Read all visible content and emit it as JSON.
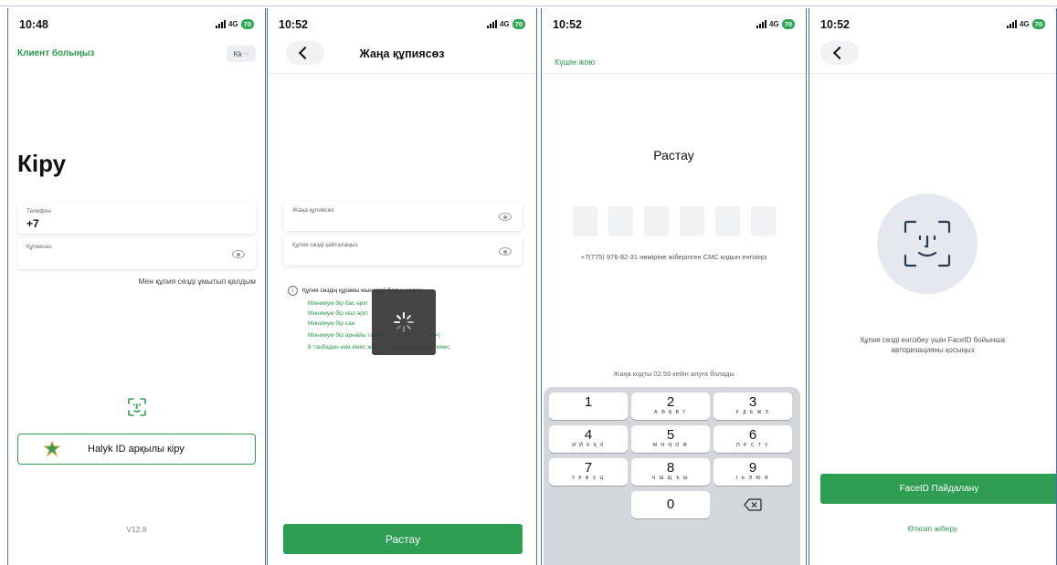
{
  "status_bar": {
    "times": [
      "10:48",
      "10:52",
      "10:52",
      "10:52"
    ],
    "network": "4G",
    "battery": "70"
  },
  "login": {
    "become_client_link": "Клиент болыңыз",
    "language": "Kk",
    "title": "Кіру",
    "phone_label": "Телефон",
    "phone_value": "+7",
    "password_label": "Құпиясөз",
    "forgot_password": "Мен құпия сөзді ұмытып қалдым",
    "halyk_button": "Halyk ID арқылы кіру",
    "version": "V12.8"
  },
  "new_password": {
    "title": "Жаңа құпиясөз",
    "new_password_label": "Жаңа құпиясөз",
    "repeat_password_label": "Құпия сөзді қайталаңыз",
    "rules_heading": "Құпия сөздің құрамы мынадай болуы керек",
    "rules": [
      "Минимум бір бас әріп",
      "Минимум бір кіші әріп",
      "Минимум бір сан",
      "Минимум бір арнайы таңба (!\"#$%&'()*+,-./:;<=>)",
      "8 таңбадан кем емес және 15 таңбадан артық емес"
    ],
    "confirm_button": "Растау"
  },
  "otp": {
    "cancel_link": "Күшін жою",
    "title": "Растау",
    "instruction": "+7(775) 976-82-31 нөміріне жіберілген СМС кодын енгізіңіз",
    "resend_timer": "Жаңа кодты 02:59 кейін алуға болады",
    "keys": [
      {
        "digit": "1",
        "letters": ""
      },
      {
        "digit": "2",
        "letters": "А Ә Б В Г"
      },
      {
        "digit": "3",
        "letters": "F Д Е Ж З"
      },
      {
        "digit": "4",
        "letters": "И Й К Қ Л"
      },
      {
        "digit": "5",
        "letters": "М Н Ң О Ө"
      },
      {
        "digit": "6",
        "letters": "П Р С Т У"
      },
      {
        "digit": "7",
        "letters": "Ү Ұ Ф Х Ц"
      },
      {
        "digit": "8",
        "letters": "Ч Ш Щ Ъ Ы"
      },
      {
        "digit": "9",
        "letters": "І Ь Э Ю Я"
      },
      {
        "digit": "0",
        "letters": ""
      }
    ]
  },
  "faceid": {
    "description": "Құпия сөзді енгізбеу үшін FaceID бойынша авторизацияны қосыңыз",
    "use_button": "FaceID Пайдалану",
    "skip_link": "Өткізіп жіберу"
  },
  "colors": {
    "accent_green": "#2d9e52",
    "frame_blue": "#4a6fb0"
  }
}
